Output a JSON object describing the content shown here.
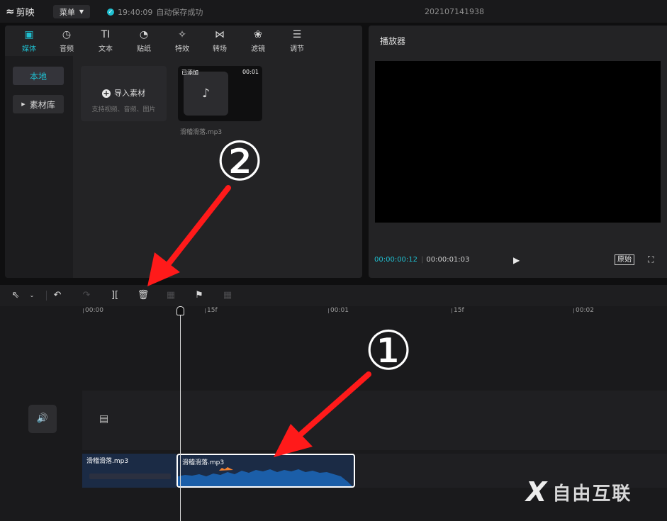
{
  "topbar": {
    "app_name": "剪映",
    "menu_label": "菜单",
    "save_time": "19:40:09",
    "save_status": "自动保存成功",
    "project_name": "202107141938"
  },
  "media_tabs": [
    {
      "label": "媒体",
      "icon": "media-icon",
      "glyph": "▣"
    },
    {
      "label": "音频",
      "icon": "audio-icon",
      "glyph": "◷"
    },
    {
      "label": "文本",
      "icon": "text-icon",
      "glyph": "TI"
    },
    {
      "label": "贴纸",
      "icon": "sticker-icon",
      "glyph": "◔"
    },
    {
      "label": "特效",
      "icon": "effects-icon",
      "glyph": "✧"
    },
    {
      "label": "转场",
      "icon": "transition-icon",
      "glyph": "⋈"
    },
    {
      "label": "滤镜",
      "icon": "filter-icon",
      "glyph": "❀"
    },
    {
      "label": "调节",
      "icon": "adjust-icon",
      "glyph": "☰"
    }
  ],
  "media_sidebar": {
    "local": "本地",
    "library": "素材库"
  },
  "import_card": {
    "label": "导入素材",
    "hint": "支持视频、音频、图片"
  },
  "media_item": {
    "badge": "已添加",
    "duration": "00:01",
    "name": "滑稽滑落.mp3"
  },
  "player": {
    "title": "播放器",
    "current_time": "00:00:00:12",
    "separator": "|",
    "total_time": "00:00:01:03",
    "ratio_label": "原始"
  },
  "timeline": {
    "ruler_labels": [
      "00:00",
      "15f",
      "00:01",
      "15f",
      "00:02"
    ],
    "clips": [
      {
        "name": "滑稽滑落.mp3"
      },
      {
        "name": "滑稽滑落.mp3"
      }
    ]
  },
  "annotations": {
    "step1": "①",
    "step2": "②"
  },
  "watermark": {
    "mark": "X",
    "text": "自由互联"
  },
  "colors": {
    "accent": "#1fbfd0",
    "annotation_arrow": "#ff1a1a",
    "clip_blue": "#1b5ea8"
  }
}
